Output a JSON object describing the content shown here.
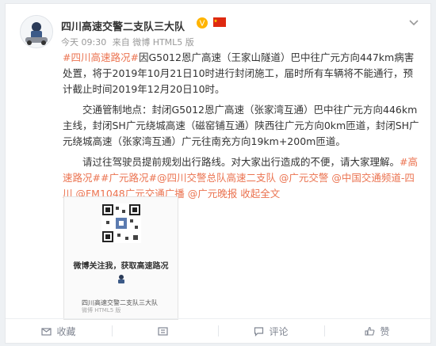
{
  "post": {
    "author": "四川高速交警二支队三大队",
    "meta": {
      "time": "今天 09:30",
      "source": "来自 微博 HTML5 版"
    },
    "tag1": "#四川高速路况#",
    "para1": "因G5012恩广高速（王家山隧道）巴中往广元方向447km病害处置，将于2019年10月21日10时进行封闭施工，届时所有车辆将不能通行，预计截止时间2019年12月20日10时。",
    "para2": "交通管制地点：封闭G5012恩广高速（张家湾互通）巴中往广元方向446km主线，封闭SH广元绕城高速（磁窑铺互通）陕西往广元方向0km匝道，封闭SH广元绕城高速（张家湾互通）广元往南充方向19km+200m匝道。",
    "para3": "请过往驾驶员提前规划出行路线。对大家出行造成的不便，请大家理解。",
    "tag2": "#高速路况#",
    "tag3": "#广元路况#",
    "mentions": "@四川交警总队高速二支队 @广元交警 @中国交通频道-四川 @FM1048广元交通广播 @广元晚报",
    "collapse": "收起全文"
  },
  "share_card": {
    "caption": "微博关注我，获取高速路况",
    "name": "四川高速交警二支队三大队",
    "sub": "微博 HTML5 版"
  },
  "footer": {
    "repost": "收藏",
    "comment": "评论",
    "like": "赞"
  },
  "colors": {
    "accent": "#eb7350",
    "verified": "#ffb400",
    "flag": "#de2910"
  }
}
